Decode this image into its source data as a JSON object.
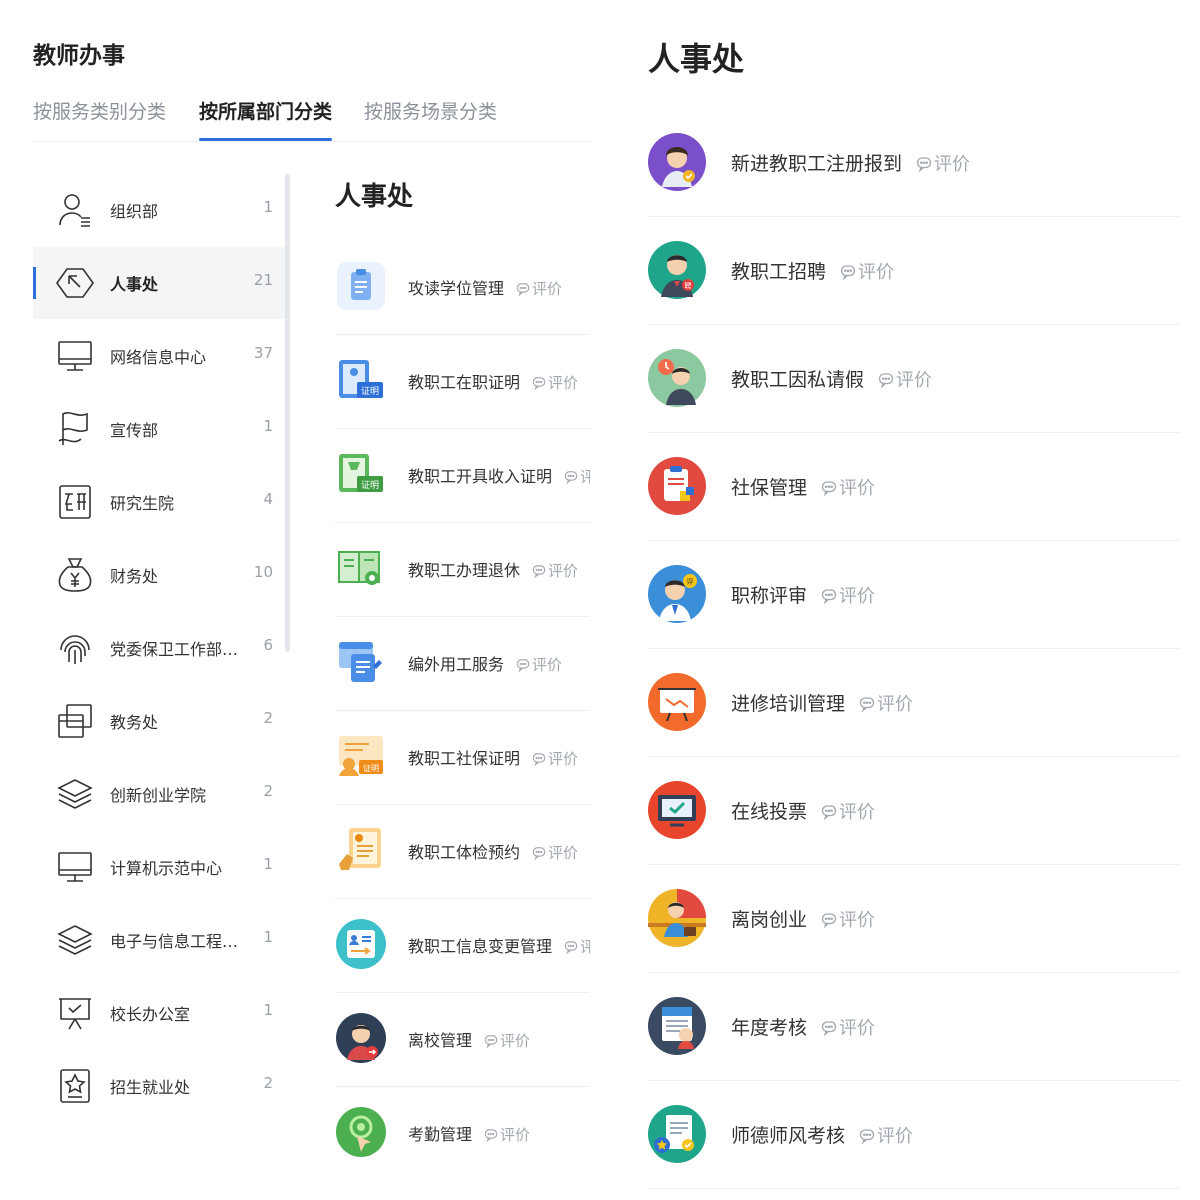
{
  "app": {
    "title": "教师办事"
  },
  "tabs": [
    {
      "label": "按服务类别分类",
      "active": false
    },
    {
      "label": "按所属部门分类",
      "active": true
    },
    {
      "label": "按服务场景分类",
      "active": false
    }
  ],
  "departments": [
    {
      "name": "组织部",
      "count": "1",
      "icon": "user-icon"
    },
    {
      "name": "人事处",
      "count": "21",
      "icon": "pointer-icon",
      "active": true
    },
    {
      "name": "网络信息中心",
      "count": "37",
      "icon": "monitor-icon"
    },
    {
      "name": "宣传部",
      "count": "1",
      "icon": "flag-icon"
    },
    {
      "name": "研究生院",
      "count": "4",
      "icon": "yan-icon"
    },
    {
      "name": "财务处",
      "count": "10",
      "icon": "money-bag-icon"
    },
    {
      "name": "党委保卫工作部…",
      "count": "6",
      "icon": "fingerprint-icon"
    },
    {
      "name": "教务处",
      "count": "2",
      "icon": "window-icon"
    },
    {
      "name": "创新创业学院",
      "count": "2",
      "icon": "layers-icon"
    },
    {
      "name": "计算机示范中心",
      "count": "1",
      "icon": "monitor-icon"
    },
    {
      "name": "电子与信息工程…",
      "count": "1",
      "icon": "layers-icon"
    },
    {
      "name": "校长办公室",
      "count": "1",
      "icon": "presentation-icon"
    },
    {
      "name": "招生就业处",
      "count": "2",
      "icon": "star-frame-icon"
    }
  ],
  "middle": {
    "title": "人事处",
    "rate_label": "评价",
    "items": [
      {
        "label": "攻读学位管理",
        "icon": "clipboard-icon"
      },
      {
        "label": "教职工在职证明",
        "icon": "certificate-icon"
      },
      {
        "label": "教职工开具收入证明",
        "icon": "income-certificate-icon"
      },
      {
        "label": "教职工办理退休",
        "icon": "retirement-book-icon"
      },
      {
        "label": "编外用工服务",
        "icon": "contract-service-icon"
      },
      {
        "label": "教职工社保证明",
        "icon": "social-security-certificate-icon"
      },
      {
        "label": "教职工体检预约",
        "icon": "medical-appointment-icon"
      },
      {
        "label": "教职工信息变更管理",
        "icon": "info-change-icon"
      },
      {
        "label": "离校管理",
        "icon": "leave-school-icon"
      },
      {
        "label": "考勤管理",
        "icon": "attendance-icon"
      }
    ]
  },
  "right": {
    "title": "人事处",
    "rate_label": "评价",
    "items": [
      {
        "label": "新进教职工注册报到",
        "icon": "new-staff-icon"
      },
      {
        "label": "教职工招聘",
        "icon": "recruitment-icon"
      },
      {
        "label": "教职工因私请假",
        "icon": "personal-leave-icon"
      },
      {
        "label": "社保管理",
        "icon": "social-security-icon"
      },
      {
        "label": "职称评审",
        "icon": "title-review-icon"
      },
      {
        "label": "进修培训管理",
        "icon": "training-board-icon"
      },
      {
        "label": "在线投票",
        "icon": "online-vote-icon"
      },
      {
        "label": "离岗创业",
        "icon": "entrepreneurship-icon"
      },
      {
        "label": "年度考核",
        "icon": "annual-assessment-icon"
      },
      {
        "label": "师德师风考核",
        "icon": "ethics-assessment-icon"
      }
    ]
  },
  "colors": {
    "accent": "#2a6fdb",
    "muted": "#9aa0a8",
    "divider": "#eceff3"
  }
}
